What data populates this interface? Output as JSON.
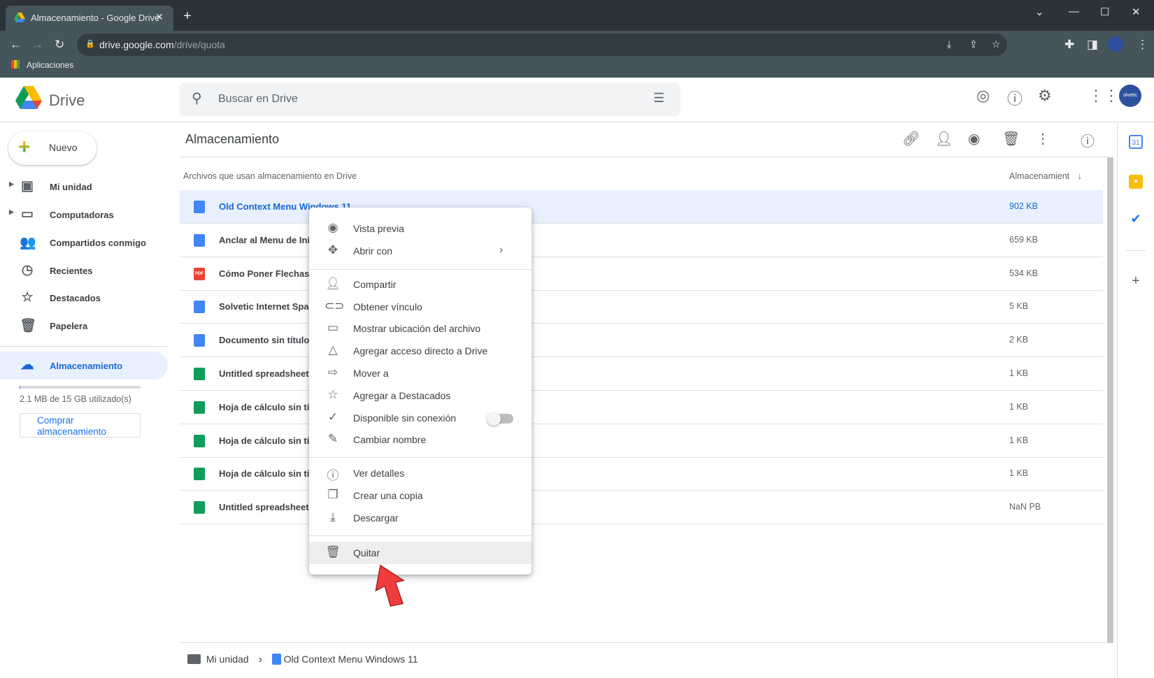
{
  "browser": {
    "tab_title": "Almacenamiento - Google Drive",
    "url_host": "drive.google.com",
    "url_path": "/drive/quota",
    "bookmark": "Aplicaciones",
    "profile": "Solvetic"
  },
  "header": {
    "app_name": "Drive",
    "search_placeholder": "Buscar en Drive",
    "avatar_text": "olvetic"
  },
  "sidebar": {
    "new_label": "Nuevo",
    "items": [
      {
        "label": "Mi unidad",
        "icon": "drive-icon"
      },
      {
        "label": "Computadoras",
        "icon": "computer-icon"
      },
      {
        "label": "Compartidos conmigo",
        "icon": "people-icon"
      },
      {
        "label": "Recientes",
        "icon": "clock-icon"
      },
      {
        "label": "Destacados",
        "icon": "star-icon"
      },
      {
        "label": "Papelera",
        "icon": "trash-icon"
      },
      {
        "label": "Almacenamiento",
        "icon": "cloud-icon",
        "active": true
      }
    ],
    "quota_text": "2.1 MB de 15 GB utilizado(s)",
    "quota_fraction": 0.00014,
    "buy_label": "Comprar almacenamiento"
  },
  "main": {
    "title": "Almacenamiento",
    "col_name": "Archivos que usan almacenamiento en Drive",
    "col_size": "Almacenamient",
    "files": [
      {
        "name": "Old Context Menu Windows 11",
        "size": "902 KB",
        "type": "doc"
      },
      {
        "name": "Anclar al Menu de Inic",
        "size": "659 KB",
        "type": "doc"
      },
      {
        "name": "Cómo Poner Flechas e",
        "size": "534 KB",
        "type": "pdf"
      },
      {
        "name": "Solvetic Internet Spain",
        "size": "5 KB",
        "type": "doc"
      },
      {
        "name": "Documento sin título",
        "size": "2 KB",
        "type": "doc"
      },
      {
        "name": "Untitled spreadsheet",
        "size": "1 KB",
        "type": "sheet"
      },
      {
        "name": "Hoja de cálculo sin títu",
        "size": "1 KB",
        "type": "sheet"
      },
      {
        "name": "Hoja de cálculo sin títu",
        "size": "1 KB",
        "type": "sheet"
      },
      {
        "name": "Hoja de cálculo sin títu",
        "size": "1 KB",
        "type": "sheet"
      },
      {
        "name": "Untitled spreadsheet",
        "size": "NaN PB",
        "type": "sheet"
      }
    ],
    "pdf_badge": "PDF"
  },
  "breadcrumb": {
    "root": "Mi unidad",
    "file": "Old Context Menu Windows 11"
  },
  "context_menu": {
    "groups": [
      [
        {
          "label": "Vista previa",
          "icon": "eye-icon"
        },
        {
          "label": "Abrir con",
          "icon": "move-icon",
          "submenu": true
        }
      ],
      [
        {
          "label": "Compartir",
          "icon": "share-person-icon"
        },
        {
          "label": "Obtener vínculo",
          "icon": "link-icon"
        },
        {
          "label": "Mostrar ubicación del archivo",
          "icon": "folder-icon"
        },
        {
          "label": "Agregar acceso directo a Drive",
          "icon": "shortcut-icon"
        },
        {
          "label": "Mover a",
          "icon": "move-folder-icon"
        },
        {
          "label": "Agregar a Destacados",
          "icon": "star-icon"
        },
        {
          "label": "Disponible sin conexión",
          "icon": "offline-icon",
          "toggle": false
        },
        {
          "label": "Cambiar nombre",
          "icon": "pencil-icon"
        }
      ],
      [
        {
          "label": "Ver detalles",
          "icon": "info-icon"
        },
        {
          "label": "Crear una copia",
          "icon": "copy-icon"
        },
        {
          "label": "Descargar",
          "icon": "download-icon"
        }
      ],
      [
        {
          "label": "Quitar",
          "icon": "trash-icon",
          "highlighted": true
        }
      ]
    ]
  },
  "right_panel": {
    "calendar_day": "31"
  },
  "colors": {
    "accent": "#1a73e8",
    "selected_row": "#e8f0fe",
    "chrome_dark": "#2b3338",
    "annotation_arrow": "#f03c3c"
  }
}
